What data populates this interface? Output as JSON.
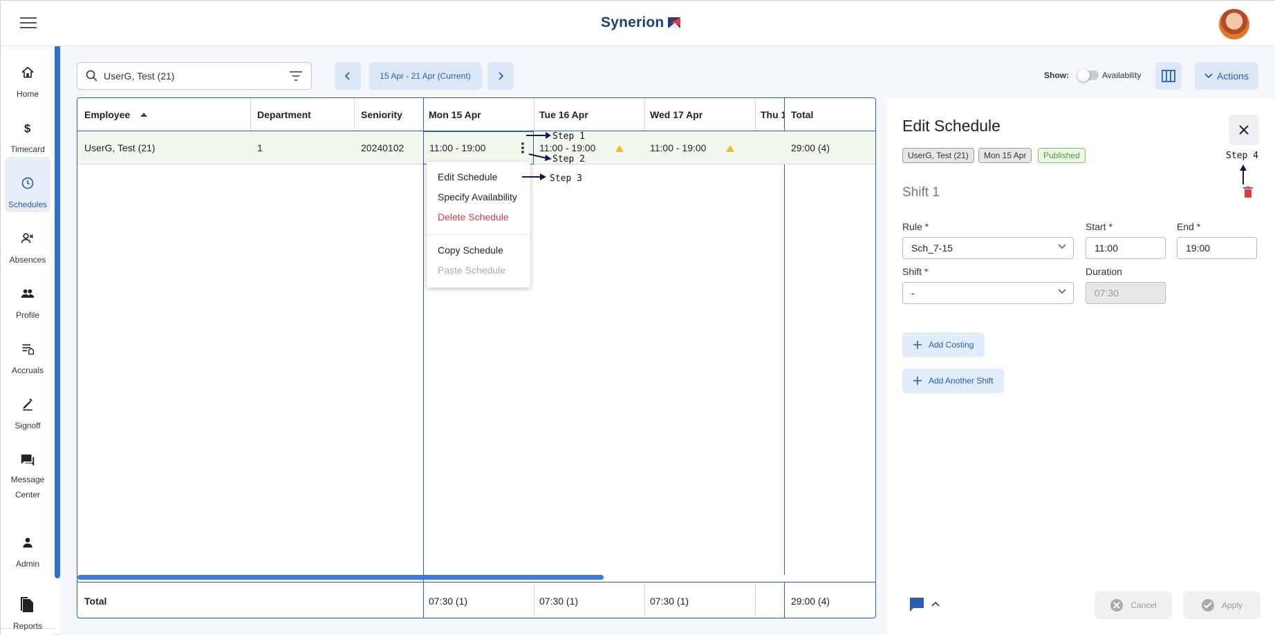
{
  "app": {
    "brand": "Synerion",
    "colors": {
      "accent": "#2a5db0",
      "danger": "#d63c3c",
      "warning": "#f1b92a",
      "published": "#4c9a32"
    }
  },
  "nav": {
    "items": [
      {
        "label": "Home",
        "icon": "home-icon"
      },
      {
        "label": "Timecard",
        "icon": "dollar-icon"
      },
      {
        "label": "Schedules",
        "icon": "clock-icon",
        "active": true
      },
      {
        "label": "Absences",
        "icon": "person-x-icon"
      },
      {
        "label": "Profile",
        "icon": "people-icon"
      },
      {
        "label": "Accruals",
        "icon": "accruals-icon"
      },
      {
        "label": "Signoff",
        "icon": "signoff-icon"
      },
      {
        "label_line1": "Message",
        "label_line2": "Center",
        "icon": "chat-icon"
      },
      {
        "label": "Admin",
        "icon": "person-icon"
      },
      {
        "label": "Reports",
        "icon": "reports-icon"
      }
    ]
  },
  "toolbar": {
    "search_value": "UserG, Test (21)",
    "date_range": "15 Apr - 21 Apr (Current)",
    "show_label": "Show:",
    "availability_label": "Availability",
    "actions_label": "Actions"
  },
  "grid": {
    "headers": [
      "Employee",
      "Department",
      "Seniority",
      "Mon 15 Apr",
      "Tue 16 Apr",
      "Wed 17 Apr",
      "Thu 1",
      "Total"
    ],
    "row": {
      "employee": "UserG, Test (21)",
      "department": "1",
      "seniority": "20240102",
      "mon": "11:00 - 19:00",
      "tue": "11:00 - 19:00",
      "wed": "11:00 - 19:00",
      "thu": "",
      "total": "29:00 (4)"
    },
    "totals": {
      "label": "Total",
      "mon": "07:30 (1)",
      "tue": "07:30 (1)",
      "wed": "07:30 (1)",
      "thu": "",
      "total": "29:00 (4)"
    }
  },
  "context_menu": {
    "items": [
      "Edit Schedule",
      "Specify Availability",
      "Delete Schedule",
      "Copy Schedule",
      "Paste Schedule"
    ]
  },
  "annotations": {
    "step1": "Step 1",
    "step2": "Step 2",
    "step3": "Step 3",
    "step4": "Step 4"
  },
  "panel": {
    "title": "Edit Schedule",
    "chips": [
      "UserG, Test (21)",
      "Mon 15 Apr",
      "Published"
    ],
    "shift_title": "Shift 1",
    "rule_label": "Rule *",
    "rule_value": "Sch_7-15",
    "start_label": "Start *",
    "start_value": "11:00",
    "end_label": "End *",
    "end_value": "19:00",
    "shift_label": "Shift *",
    "shift_value": "-",
    "duration_label": "Duration",
    "duration_value": "07:30",
    "add_costing": "Add Costing",
    "add_shift": "Add Another Shift",
    "cancel": "Cancel",
    "apply": "Apply"
  }
}
